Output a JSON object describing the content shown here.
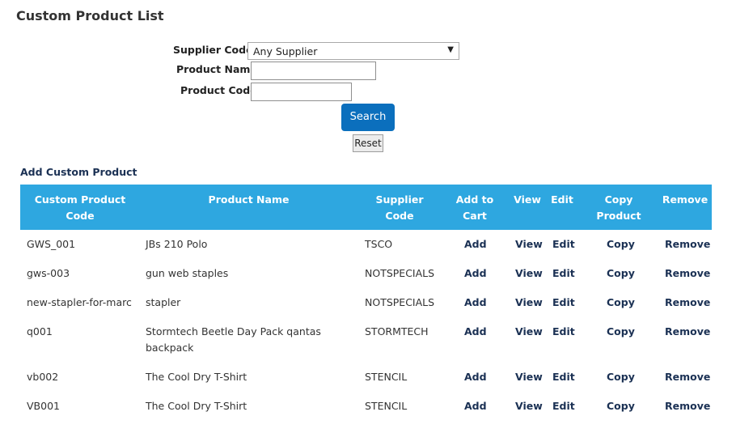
{
  "page": {
    "title": "Custom Product List"
  },
  "filters": {
    "supplier_label": "Supplier Code:",
    "supplier_selected": "Any Supplier",
    "product_name_label": "Product Name",
    "product_name_value": "",
    "product_code_label": "Product Code",
    "product_code_value": "",
    "search_label": "Search",
    "reset_label": "Reset"
  },
  "add_custom_product_label": "Add Custom Product",
  "table": {
    "headers": {
      "code": "Custom Product Code",
      "name": "Product Name",
      "supplier": "Supplier Code",
      "add": "Add to Cart",
      "view": "View",
      "edit": "Edit",
      "copy": "Copy Product",
      "remove": "Remove"
    },
    "action_labels": {
      "add": "Add",
      "view": "View",
      "edit": "Edit",
      "copy": "Copy",
      "remove": "Remove"
    },
    "rows": [
      {
        "code": "GWS_001",
        "name": "JBs 210 Polo",
        "supplier": "TSCO"
      },
      {
        "code": "gws-003",
        "name": "gun web staples",
        "supplier": "NOTSPECIALS"
      },
      {
        "code": "new-stapler-for-marc",
        "name": "stapler",
        "supplier": "NOTSPECIALS"
      },
      {
        "code": "q001",
        "name": "Stormtech Beetle Day Pack qantas backpack",
        "supplier": "STORMTECH"
      },
      {
        "code": "vb002",
        "name": "The Cool Dry T-Shirt",
        "supplier": "STENCIL"
      },
      {
        "code": "VB001",
        "name": "The Cool Dry T-Shirt",
        "supplier": "STENCIL"
      }
    ]
  },
  "colors": {
    "header_bg": "#2ea7e0",
    "search_button_bg": "#0b6fbd",
    "link_color": "#1b3154"
  }
}
